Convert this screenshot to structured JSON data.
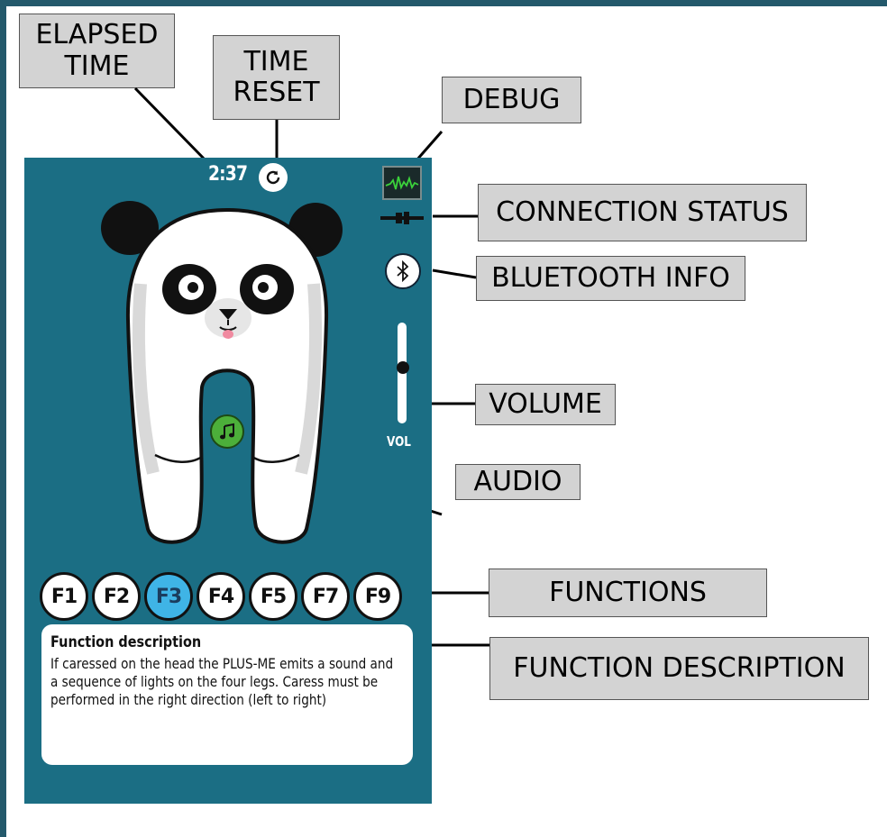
{
  "labels": {
    "elapsed_time": "ELAPSED TIME",
    "time_reset": "TIME RESET",
    "debug": "DEBUG",
    "connection_status": "CONNECTION STATUS",
    "bluetooth_info": "BLUETOOTH INFO",
    "volume": "VOLUME",
    "audio": "AUDIO",
    "functions": "FUNCTIONS",
    "function_description": "FUNCTION DESCRIPTION"
  },
  "app": {
    "elapsed_time": "2:37",
    "volume_label": "VOL",
    "volume_level": 0.55,
    "functions": [
      {
        "label": "F1",
        "active": false
      },
      {
        "label": "F2",
        "active": false
      },
      {
        "label": "F3",
        "active": true
      },
      {
        "label": "F4",
        "active": false
      },
      {
        "label": "F5",
        "active": false
      },
      {
        "label": "F7",
        "active": false
      },
      {
        "label": "F9",
        "active": false
      }
    ],
    "description": {
      "title": "Function description",
      "text": "If caressed on the head the PLUS-ME emits a sound and a sequence of lights on the four legs. Caress must be performed in the right direction (left to right)"
    }
  },
  "colors": {
    "frame": "#23596b",
    "phone_bg": "#1b6e84",
    "label_bg": "#d3d3d3",
    "active_function": "#3fb4e6",
    "audio_button": "#4caf3a"
  },
  "icons": {
    "reset": "refresh-icon",
    "debug": "waveform-icon",
    "connection": "plug-icon",
    "bluetooth": "bluetooth-icon",
    "audio": "music-note-icon"
  }
}
